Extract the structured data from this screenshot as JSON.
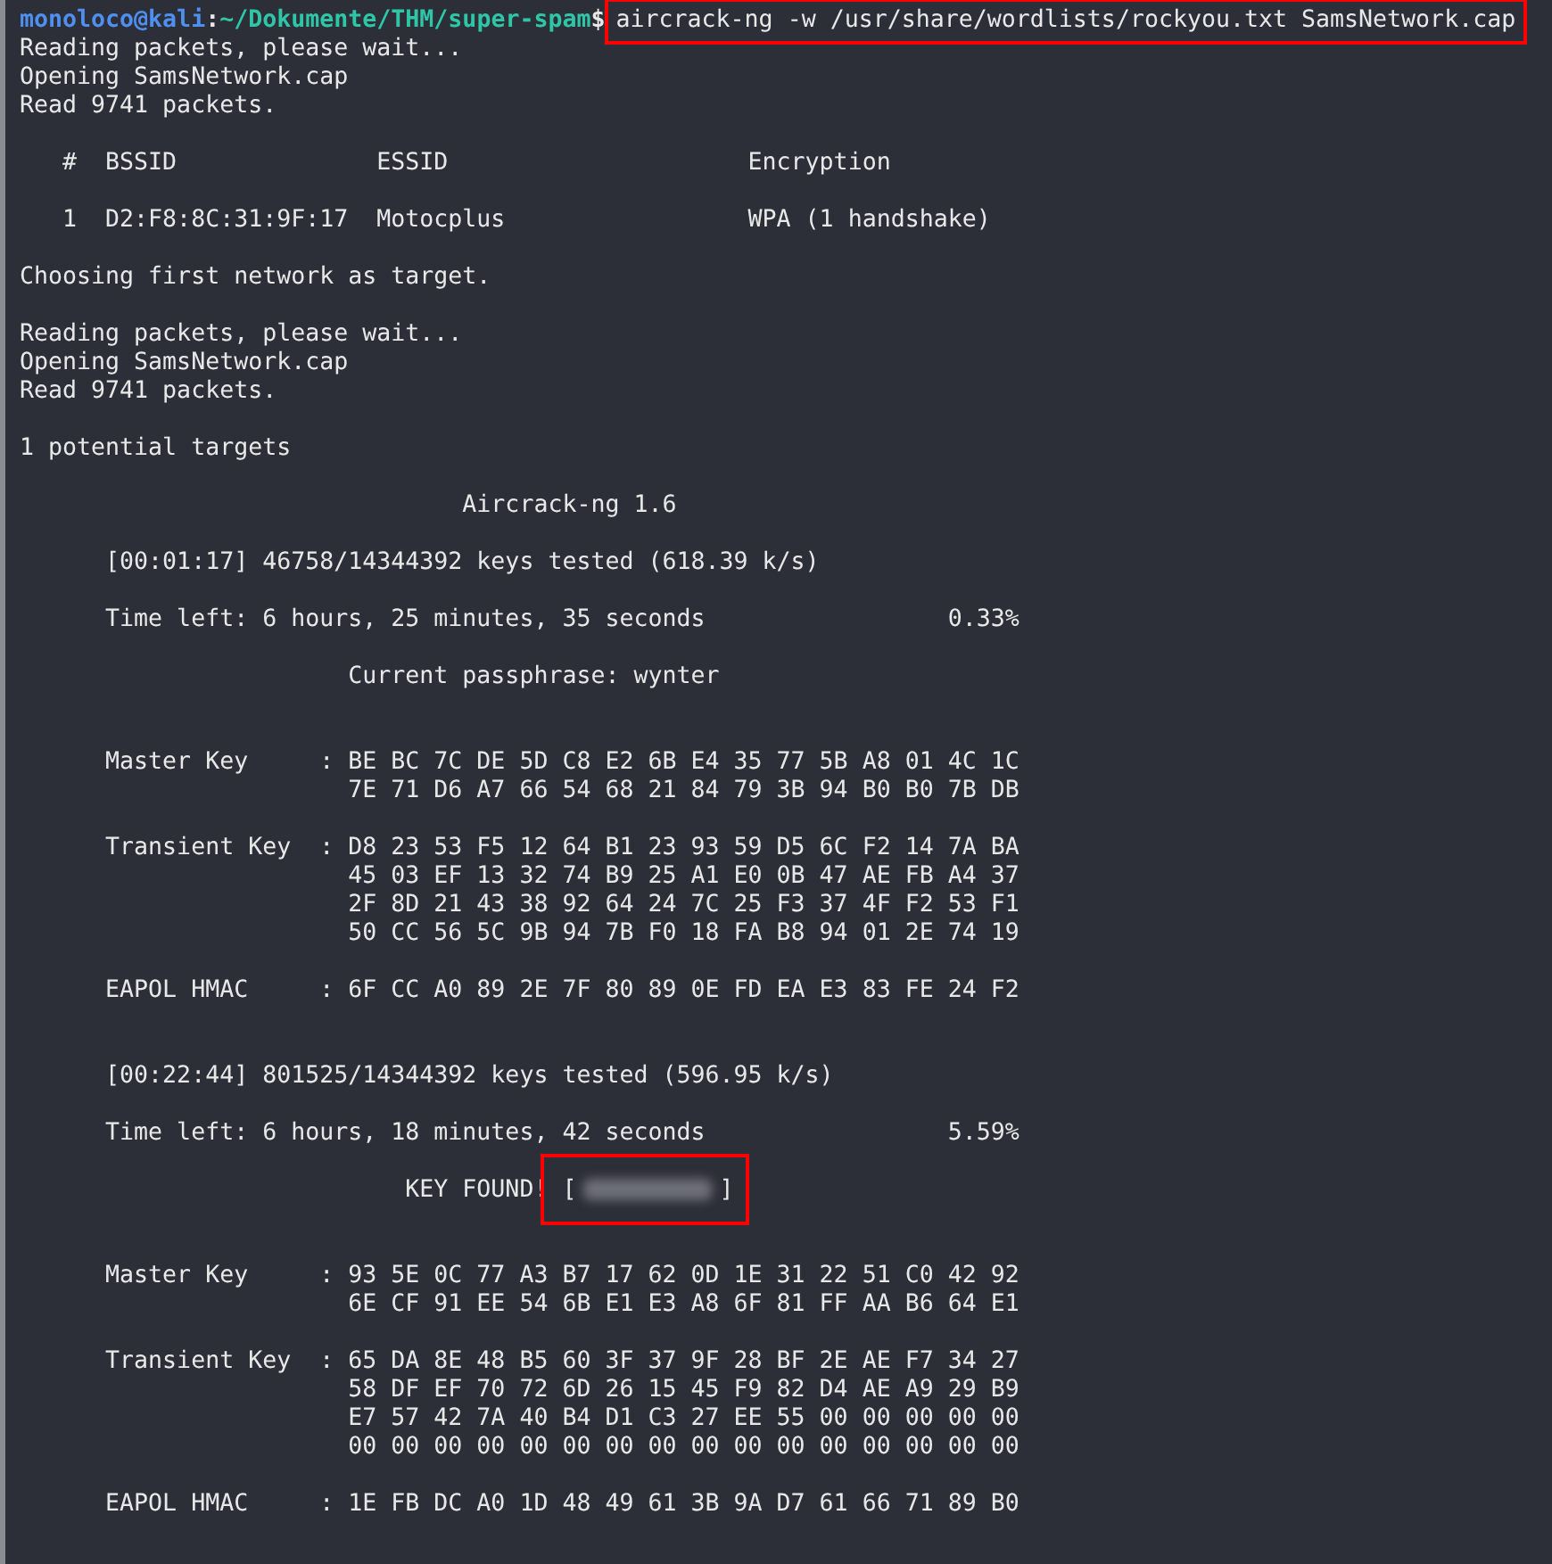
{
  "terminal": {
    "lines": [
      {
        "kind": "prompt",
        "user_host": "monoloco@kali",
        "separator": ":",
        "path": "~/Dokumente/THM/super-spam",
        "symbol": "$",
        "command": "aircrack-ng -w /usr/share/wordlists/rockyou.txt SamsNetwork.cap",
        "highlighted": true
      },
      {
        "kind": "text",
        "text": "Reading packets, please wait..."
      },
      {
        "kind": "text",
        "text": "Opening SamsNetwork.cap"
      },
      {
        "kind": "text",
        "text": "Read 9741 packets."
      },
      {
        "kind": "blank"
      },
      {
        "kind": "text",
        "text": "   #  BSSID              ESSID                     Encryption"
      },
      {
        "kind": "blank"
      },
      {
        "kind": "text",
        "text": "   1  D2:F8:8C:31:9F:17  Motocplus                 WPA (1 handshake)"
      },
      {
        "kind": "blank"
      },
      {
        "kind": "text",
        "text": "Choosing first network as target."
      },
      {
        "kind": "blank"
      },
      {
        "kind": "text",
        "text": "Reading packets, please wait..."
      },
      {
        "kind": "text",
        "text": "Opening SamsNetwork.cap"
      },
      {
        "kind": "text",
        "text": "Read 9741 packets."
      },
      {
        "kind": "blank"
      },
      {
        "kind": "text",
        "text": "1 potential targets"
      },
      {
        "kind": "blank"
      },
      {
        "kind": "text",
        "text": "                               Aircrack-ng 1.6"
      },
      {
        "kind": "blank"
      },
      {
        "kind": "text",
        "text": "      [00:01:17] 46758/14344392 keys tested (618.39 k/s)"
      },
      {
        "kind": "blank"
      },
      {
        "kind": "text",
        "text": "      Time left: 6 hours, 25 minutes, 35 seconds                 0.33%"
      },
      {
        "kind": "blank"
      },
      {
        "kind": "text",
        "text": "                       Current passphrase: wynter"
      },
      {
        "kind": "blank"
      },
      {
        "kind": "blank"
      },
      {
        "kind": "text",
        "text": "      Master Key     : BE BC 7C DE 5D C8 E2 6B E4 35 77 5B A8 01 4C 1C"
      },
      {
        "kind": "text",
        "text": "                       7E 71 D6 A7 66 54 68 21 84 79 3B 94 B0 B0 7B DB"
      },
      {
        "kind": "blank"
      },
      {
        "kind": "text",
        "text": "      Transient Key  : D8 23 53 F5 12 64 B1 23 93 59 D5 6C F2 14 7A BA"
      },
      {
        "kind": "text",
        "text": "                       45 03 EF 13 32 74 B9 25 A1 E0 0B 47 AE FB A4 37"
      },
      {
        "kind": "text",
        "text": "                       2F 8D 21 43 38 92 64 24 7C 25 F3 37 4F F2 53 F1"
      },
      {
        "kind": "text",
        "text": "                       50 CC 56 5C 9B 94 7B F0 18 FA B8 94 01 2E 74 19"
      },
      {
        "kind": "blank"
      },
      {
        "kind": "text",
        "text": "      EAPOL HMAC     : 6F CC A0 89 2E 7F 80 89 0E FD EA E3 83 FE 24 F2"
      },
      {
        "kind": "blank"
      },
      {
        "kind": "blank"
      },
      {
        "kind": "text",
        "text": "      [00:22:44] 801525/14344392 keys tested (596.95 k/s)"
      },
      {
        "kind": "blank"
      },
      {
        "kind": "text",
        "text": "      Time left: 6 hours, 18 minutes, 42 seconds                 5.59%"
      },
      {
        "kind": "blank"
      },
      {
        "kind": "key_found",
        "label": "                           KEY FOUND! ",
        "open": "[",
        "close": "]",
        "highlighted": true
      },
      {
        "kind": "blank"
      },
      {
        "kind": "blank"
      },
      {
        "kind": "text",
        "text": "      Master Key     : 93 5E 0C 77 A3 B7 17 62 0D 1E 31 22 51 C0 42 92"
      },
      {
        "kind": "text",
        "text": "                       6E CF 91 EE 54 6B E1 E3 A8 6F 81 FF AA B6 64 E1"
      },
      {
        "kind": "blank"
      },
      {
        "kind": "text",
        "text": "      Transient Key  : 65 DA 8E 48 B5 60 3F 37 9F 28 BF 2E AE F7 34 27"
      },
      {
        "kind": "text",
        "text": "                       58 DF EF 70 72 6D 26 15 45 F9 82 D4 AE A9 29 B9"
      },
      {
        "kind": "text",
        "text": "                       E7 57 42 7A 40 B4 D1 C3 27 EE 55 00 00 00 00 00"
      },
      {
        "kind": "text",
        "text": "                       00 00 00 00 00 00 00 00 00 00 00 00 00 00 00 00"
      },
      {
        "kind": "blank"
      },
      {
        "kind": "text",
        "text": "      EAPOL HMAC     : 1E FB DC A0 1D 48 49 61 3B 9A D7 61 66 71 89 B0"
      }
    ]
  }
}
